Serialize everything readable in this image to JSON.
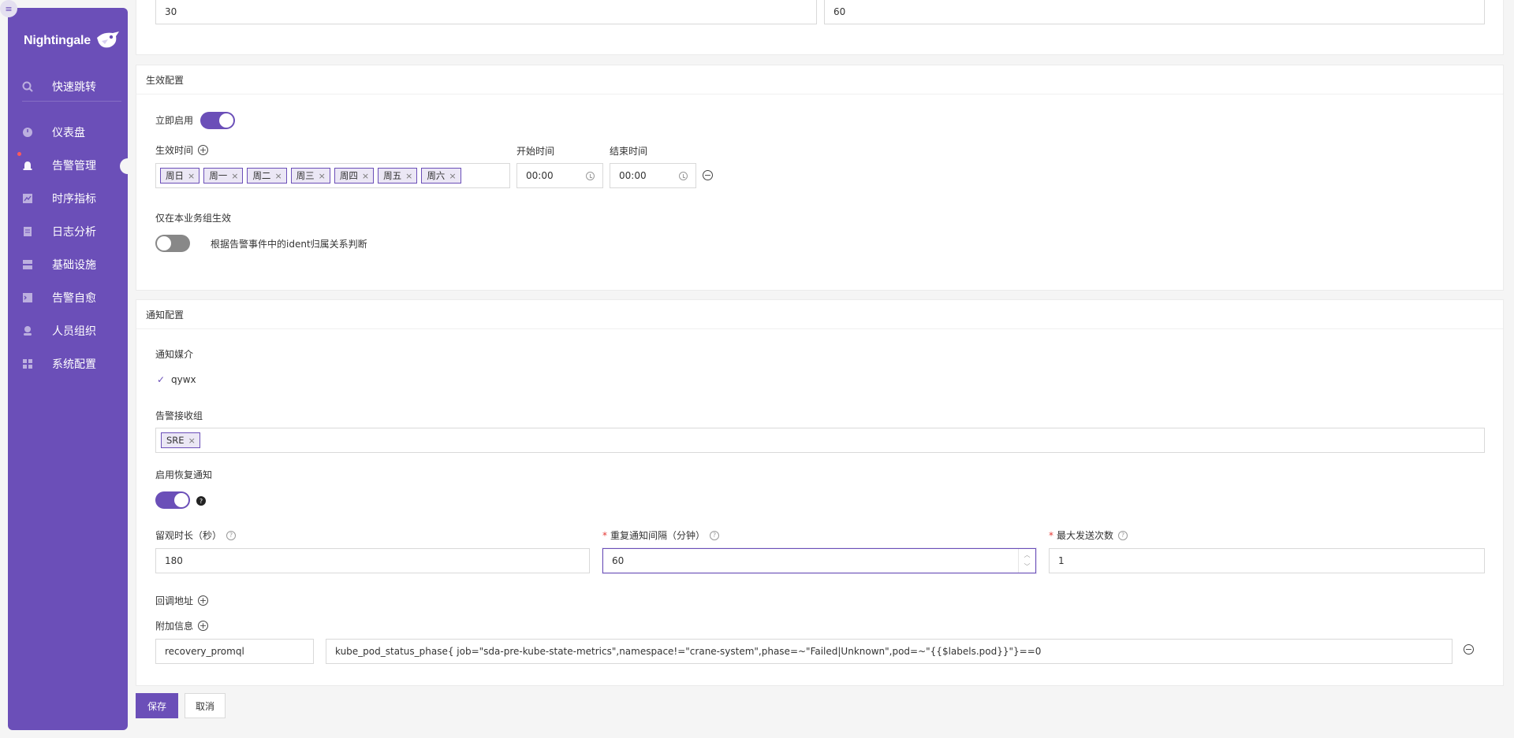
{
  "sidebar": {
    "logo_text": "Nightingale",
    "collapse_icon": "menu-icon",
    "items": [
      {
        "label": "快速跳转",
        "icon": "search-icon"
      },
      {
        "label": "仪表盘",
        "icon": "dashboard-icon"
      },
      {
        "label": "告警管理",
        "icon": "alarm-icon",
        "active": true
      },
      {
        "label": "时序指标",
        "icon": "chart-icon"
      },
      {
        "label": "日志分析",
        "icon": "log-icon"
      },
      {
        "label": "基础设施",
        "icon": "server-icon"
      },
      {
        "label": "告警自愈",
        "icon": "terminal-icon"
      },
      {
        "label": "人员组织",
        "icon": "user-icon"
      },
      {
        "label": "系统配置",
        "icon": "settings-icon"
      }
    ]
  },
  "top_inputs": {
    "left_value": "30",
    "right_value": "60"
  },
  "effective": {
    "title": "生效配置",
    "enable_label": "立即启用",
    "time_label": "生效时间",
    "days": [
      "周日",
      "周一",
      "周二",
      "周三",
      "周四",
      "周五",
      "周六"
    ],
    "start_label": "开始时间",
    "start_value": "00:00",
    "end_label": "结束时间",
    "end_value": "00:00",
    "biz_label": "仅在本业务组生效",
    "biz_desc": "根据告警事件中的ident归属关系判断"
  },
  "notify": {
    "title": "通知配置",
    "media_label": "通知媒介",
    "media_option": "qywx",
    "group_label": "告警接收组",
    "group_tags": [
      "SRE"
    ],
    "recover_label": "启用恢复通知",
    "observe_label": "留观时长（秒）",
    "observe_value": "180",
    "repeat_label": "重复通知间隔（分钟）",
    "repeat_value": "60",
    "max_label": "最大发送次数",
    "max_value": "1",
    "callback_label": "回调地址",
    "extra_label": "附加信息",
    "extra_key": "recovery_promql",
    "extra_value": "kube_pod_status_phase{ job=\"sda-pre-kube-state-metrics\",namespace!=\"crane-system\",phase=~\"Failed|Unknown\",pod=~\"{{$labels.pod}}\"}==0"
  },
  "actions": {
    "save": "保存",
    "cancel": "取消"
  },
  "colors": {
    "primary": "#6b4fb8",
    "sidebar_bg": "#6b4fb8",
    "page_bg": "#f5f5f5"
  }
}
